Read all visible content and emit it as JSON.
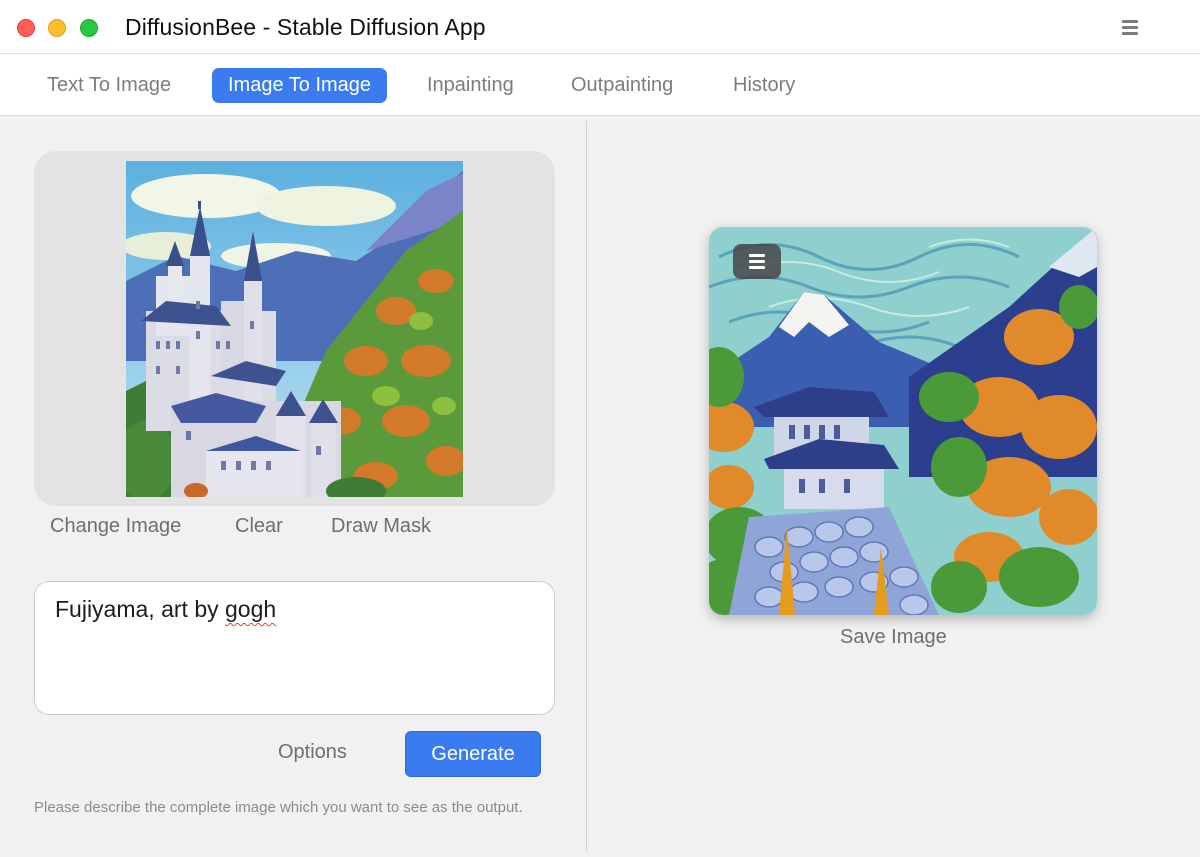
{
  "window": {
    "title": "DiffusionBee - Stable Diffusion App",
    "controls": [
      "close",
      "minimize",
      "zoom"
    ]
  },
  "tabs": [
    {
      "label": "Text To Image",
      "active": false
    },
    {
      "label": "Image To Image",
      "active": true
    },
    {
      "label": "Inpainting",
      "active": false
    },
    {
      "label": "Outpainting",
      "active": false
    },
    {
      "label": "History",
      "active": false
    }
  ],
  "input_image": {
    "actions": {
      "change": "Change Image",
      "clear": "Clear",
      "mask": "Draw Mask"
    }
  },
  "prompt": {
    "value_plain": "Fujiyama, art by ",
    "value_misspelled": "gogh"
  },
  "controls": {
    "options_label": "Options",
    "generate_label": "Generate",
    "hint": "Please describe the complete image which you want to see as the output."
  },
  "output": {
    "save_label": "Save Image"
  },
  "colors": {
    "accent": "#3a7bf0",
    "panel": "#f1f1f1",
    "image_box": "#e3e3e3"
  },
  "icons": {
    "window_menu": "hamburger-icon",
    "output_menu": "hamburger-icon"
  }
}
